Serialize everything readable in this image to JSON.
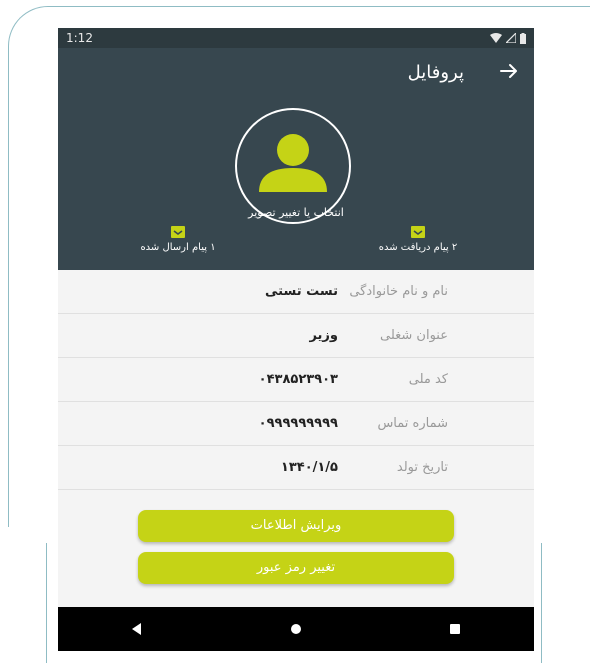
{
  "status_bar": {
    "time": "1:12"
  },
  "toolbar": {
    "title": "پروفایل"
  },
  "header": {
    "avatar_label": "انتخاب یا تغییر تصویر",
    "received_label": "۲ پیام دریافت شده",
    "sent_label": "۱ پیام ارسال شده"
  },
  "profile": {
    "rows": [
      {
        "label": "نام و نام خانوادگی",
        "value": "تست تستی"
      },
      {
        "label": "عنوان شغلی",
        "value": "وزیر"
      },
      {
        "label": "کد ملی",
        "value": "۰۴۳۸۵۲۳۹۰۳"
      },
      {
        "label": "شماره تماس",
        "value": "۰۹۹۹۹۹۹۹۹۹"
      },
      {
        "label": "تاریخ تولد",
        "value": "۱۳۴۰/۱/۵"
      }
    ]
  },
  "buttons": {
    "edit_info": "ویرایش اطلاعات",
    "change_password": "تغییر رمز عبور"
  },
  "icons": {
    "back": "arrow-right-icon",
    "avatar": "user-avatar-icon",
    "envelope": "envelope-icon",
    "nav_back": "triangle-back-icon",
    "nav_home": "circle-home-icon",
    "nav_recents": "square-recents-icon"
  },
  "colors": {
    "accent": "#c5d316",
    "header": "#37474f",
    "statusbar": "#2d3a3f"
  }
}
